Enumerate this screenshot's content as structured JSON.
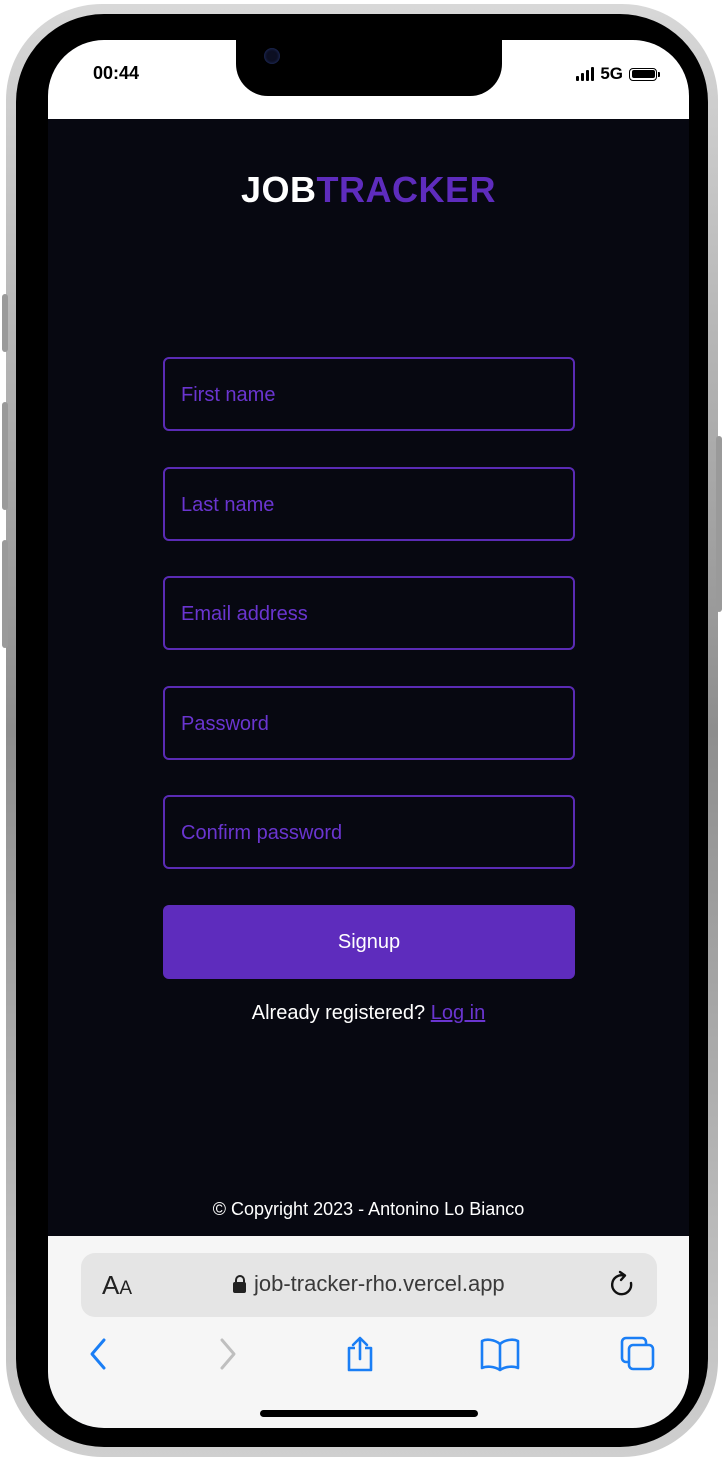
{
  "status_bar": {
    "time": "00:44",
    "network": "5G"
  },
  "app": {
    "logo_part1": "JOB",
    "logo_part2": "TRACKER",
    "form": {
      "first_name_placeholder": "First name",
      "last_name_placeholder": "Last name",
      "email_placeholder": "Email address",
      "password_placeholder": "Password",
      "confirm_password_placeholder": "Confirm password",
      "signup_label": "Signup"
    },
    "login_prompt": "Already registered?",
    "login_link": "Log in",
    "copyright": "© Copyright 2023 - Antonino Lo Bianco",
    "colors": {
      "accent": "#5e2cbd",
      "background": "#070811"
    }
  },
  "browser": {
    "text_size_label": "A",
    "text_size_label_small": "A",
    "url": "job-tracker-rho.vercel.app",
    "icons": [
      "reader-text-size-icon",
      "lock-icon",
      "reload-icon",
      "back-icon",
      "forward-icon",
      "share-icon",
      "bookmarks-icon",
      "tabs-icon"
    ]
  }
}
